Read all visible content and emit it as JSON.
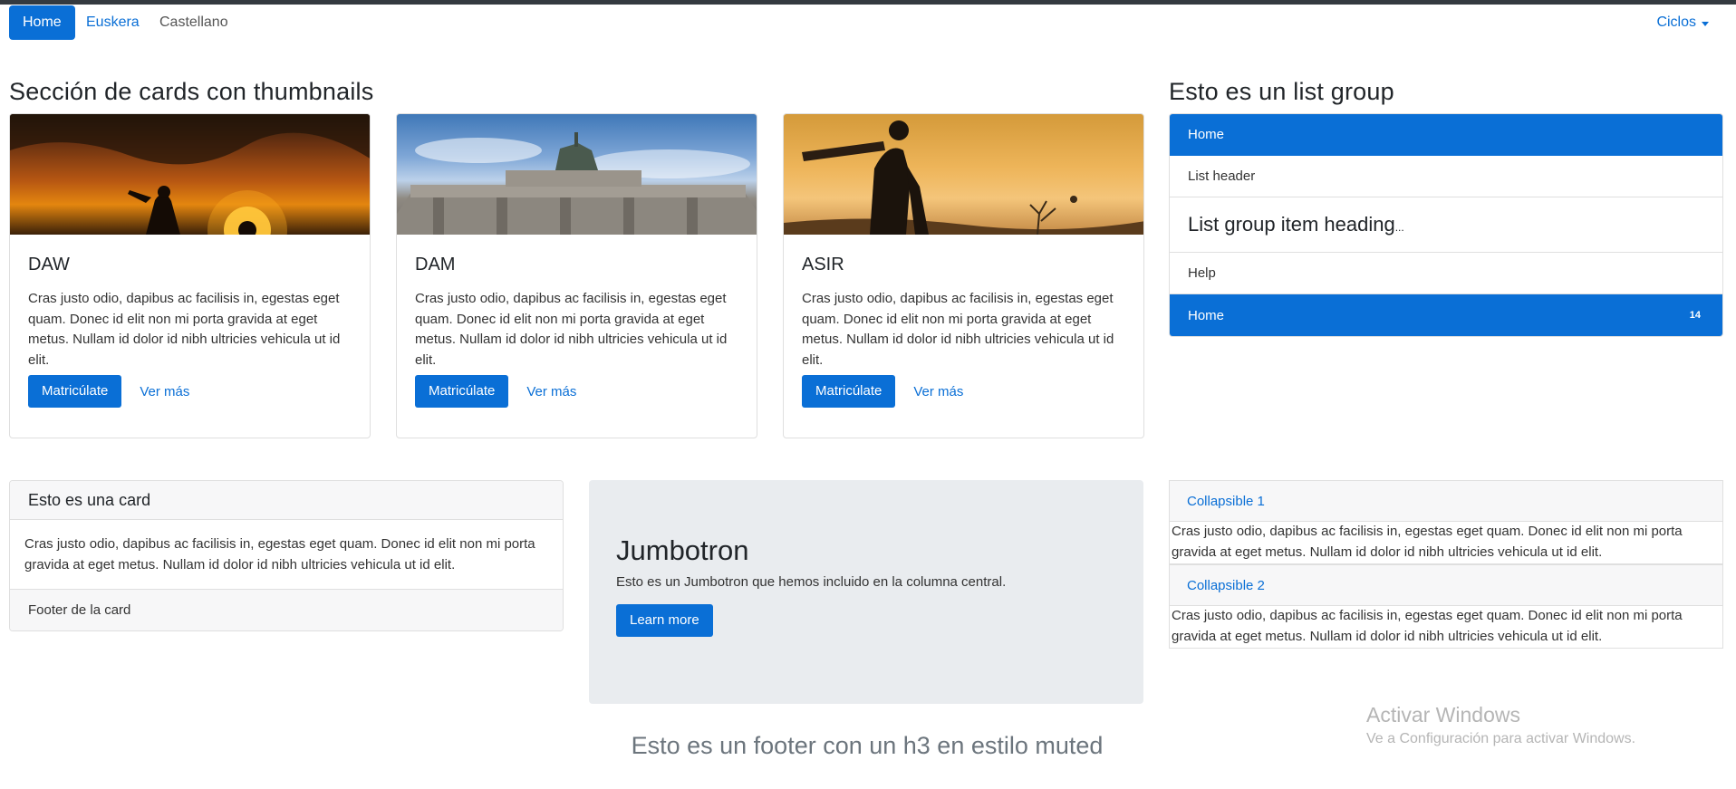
{
  "nav": {
    "home": "Home",
    "euskera": "Euskera",
    "castellano": "Castellano",
    "ciclos": "Ciclos"
  },
  "sections": {
    "cards_title": "Sección de cards con thumbnails",
    "list_title": "Esto es un list group"
  },
  "cards": [
    {
      "title": "DAW",
      "text": "Cras justo odio, dapibus ac facilisis in, egestas eget quam. Donec id elit non mi porta gravida at eget metus. Nullam id dolor id nibh ultricies vehicula ut id elit.",
      "button": "Matricúlate",
      "link": "Ver más"
    },
    {
      "title": "DAM",
      "text": "Cras justo odio, dapibus ac facilisis in, egestas eget quam. Donec id elit non mi porta gravida at eget metus. Nullam id dolor id nibh ultricies vehicula ut id elit.",
      "button": "Matricúlate",
      "link": "Ver más"
    },
    {
      "title": "ASIR",
      "text": "Cras justo odio, dapibus ac facilisis in, egestas eget quam. Donec id elit non mi porta gravida at eget metus. Nullam id dolor id nibh ultricies vehicula ut id elit.",
      "button": "Matricúlate",
      "link": "Ver más"
    }
  ],
  "list_group": {
    "item1": "Home",
    "item2": "List header",
    "item3": "List group item heading",
    "item3_suffix": "...",
    "item4": "Help",
    "item5": "Home",
    "item5_badge": "14"
  },
  "card2": {
    "header": "Esto es una card",
    "body": "Cras justo odio, dapibus ac facilisis in, egestas eget quam. Donec id elit non mi porta gravida at eget metus. Nullam id dolor id nibh ultricies vehicula ut id elit.",
    "footer": "Footer de la card"
  },
  "jumbotron": {
    "title": "Jumbotron",
    "text": "Esto es un Jumbotron que hemos incluido en la columna central.",
    "button": "Learn more"
  },
  "collapsibles": [
    {
      "title": "Collapsible 1",
      "body": "Cras justo odio, dapibus ac facilisis in, egestas eget quam. Donec id elit non mi porta gravida at eget metus. Nullam id dolor id nibh ultricies vehicula ut id elit."
    },
    {
      "title": "Collapsible 2",
      "body": "Cras justo odio, dapibus ac facilisis in, egestas eget quam. Donec id elit non mi porta gravida at eget metus. Nullam id dolor id nibh ultricies vehicula ut id elit."
    }
  ],
  "footer": {
    "text": "Esto es un footer con un h3 en estilo muted"
  },
  "watermark": {
    "title": "Activar Windows",
    "subtitle": "Ve a Configuración para activar Windows."
  },
  "colors": {
    "primary": "#0a6fd6",
    "jumbotron_bg": "#e9ecef",
    "muted": "#6c757d"
  }
}
